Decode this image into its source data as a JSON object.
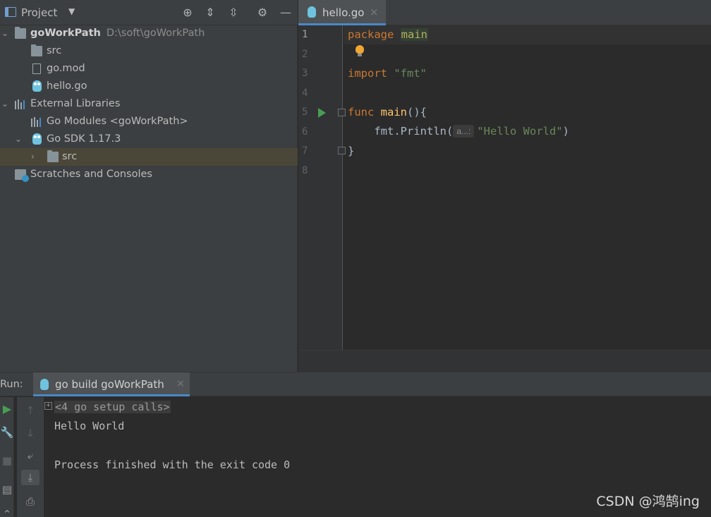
{
  "project_panel": {
    "title": "Project",
    "header_buttons": [
      "locate-icon",
      "expand-all-icon",
      "collapse-all-icon",
      "gear-icon",
      "hide-icon"
    ],
    "tree": [
      {
        "label": "goWorkPath",
        "path": "D:\\soft\\goWorkPath",
        "icon": "folder-icon",
        "expanded": true
      },
      {
        "label": "src",
        "icon": "folder-icon"
      },
      {
        "label": "go.mod",
        "icon": "file-icon"
      },
      {
        "label": "hello.go",
        "icon": "gopher-icon"
      },
      {
        "label": "External Libraries",
        "icon": "libraries-icon",
        "expanded": true
      },
      {
        "label": "Go Modules <goWorkPath>",
        "icon": "libraries-icon"
      },
      {
        "label": "Go SDK 1.17.3",
        "icon": "gopher-icon",
        "expanded": true
      },
      {
        "label": "src",
        "icon": "folder-icon",
        "expanded": false,
        "selected": true
      },
      {
        "label": "Scratches and Consoles",
        "icon": "scratch-icon"
      }
    ]
  },
  "editor": {
    "tab": {
      "label": "hello.go",
      "close": "×"
    },
    "line_numbers": [
      "1",
      "2",
      "3",
      "4",
      "5",
      "6",
      "7",
      "8"
    ],
    "code": {
      "l1_kw": "package",
      "l1_pkg": "main",
      "l3_kw": "import",
      "l3_str": "\"fmt\"",
      "l5_kw": "func",
      "l5_fn": "main",
      "l5_rest": "(){",
      "l6_call": "fmt.Println(",
      "l6_hint": "a...:",
      "l6_str": "\"Hello World\"",
      "l6_end": ")",
      "l7": "}"
    }
  },
  "run_panel": {
    "label": "Run:",
    "tab": {
      "label": "go build goWorkPath",
      "close": "×"
    },
    "console": {
      "setup_calls": "<4 go setup calls>",
      "output": "Hello World",
      "exit_message": "Process finished with the exit code 0"
    }
  },
  "watermark": "CSDN @鸿鹄ing",
  "colors": {
    "keyword": "#cc7832",
    "function": "#ffc66d",
    "string": "#6a8759",
    "selection": "#4b4738",
    "run_green": "#499c54",
    "tab_underline": "#4a88c7"
  }
}
